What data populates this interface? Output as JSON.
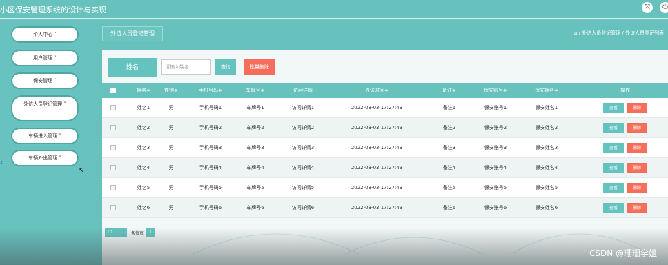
{
  "app": {
    "title": "小区保安管理系统的设计与实现",
    "btn_expand": "⤧",
    "btn_exit": "⏻"
  },
  "sidebar": {
    "items": [
      {
        "label": "个人中心 ˅"
      },
      {
        "label": "用户管理 ˅"
      },
      {
        "label": "保安管理 ˅"
      },
      {
        "label": "外访人员登记管理 ˅"
      },
      {
        "label": "车辆进入管理 ˅"
      },
      {
        "label": "车辆外出管理 ˅"
      }
    ]
  },
  "breadcrumb": {
    "current": "外访人员登记管理",
    "path": "⌂ / 外访人员登记管理 / 外访人员登记列表"
  },
  "search": {
    "label": "姓名",
    "placeholder": "请输入姓名",
    "query_button": "查询",
    "batch_delete_button": "批量删除"
  },
  "table": {
    "headers": [
      "姓名≑",
      "性别≑",
      "手机号码≑",
      "车牌号≑",
      "访问详情",
      "外访时间≑",
      "备注≑",
      "保安账号≑",
      "保安姓名≑",
      "操作"
    ],
    "rows": [
      [
        "姓名1",
        "男",
        "手机号码1",
        "车牌号1",
        "访问详情1",
        "2022-03-03 17:27:43",
        "备注1",
        "保安账号1",
        "保安姓名1"
      ],
      [
        "姓名2",
        "男",
        "手机号码2",
        "车牌号2",
        "访问详情2",
        "2022-03-03 17:27:43",
        "备注2",
        "保安账号2",
        "保安姓名2"
      ],
      [
        "姓名3",
        "男",
        "手机号码3",
        "车牌号3",
        "访问详情3",
        "2022-03-03 17:27:43",
        "备注3",
        "保安账号3",
        "保安姓名3"
      ],
      [
        "姓名4",
        "男",
        "手机号码4",
        "车牌号4",
        "访问详情4",
        "2022-03-03 17:27:43",
        "备注4",
        "保安账号4",
        "保安姓名4"
      ],
      [
        "姓名5",
        "男",
        "手机号码5",
        "车牌号5",
        "访问详情5",
        "2022-03-03 17:27:43",
        "备注5",
        "保安账号5",
        "保安姓名5"
      ],
      [
        "姓名6",
        "男",
        "手机号码6",
        "车牌号6",
        "访问详情6",
        "2022-03-03 17:27:43",
        "备注6",
        "保安账号6",
        "保安姓名6"
      ]
    ],
    "view_label": "查看",
    "delete_label": "删除"
  },
  "pagination": {
    "page_size": "10",
    "page_size_unit": "条每页",
    "current_page": "1"
  },
  "watermark": "CSDN @珊珊学姐",
  "colors": {
    "accent": "#67c2be",
    "danger": "#f56d5b"
  }
}
